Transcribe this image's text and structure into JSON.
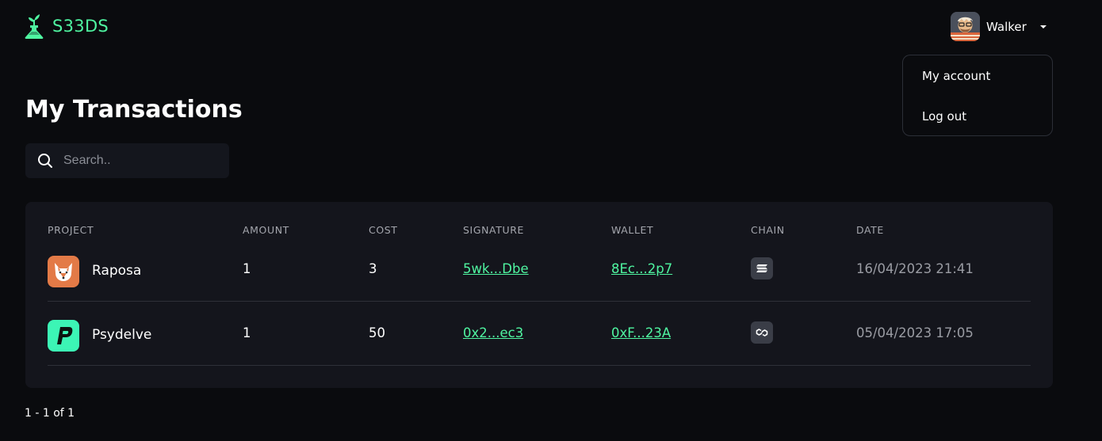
{
  "header": {
    "brand": "S33DS",
    "user_name": "Walker"
  },
  "user_menu": {
    "items": [
      {
        "label": "My account"
      },
      {
        "label": "Log out"
      }
    ]
  },
  "page": {
    "title": "My Transactions"
  },
  "search": {
    "placeholder": "Search..",
    "value": ""
  },
  "table": {
    "columns": [
      "PROJECT",
      "AMOUNT",
      "COST",
      "SIGNATURE",
      "WALLET",
      "CHAIN",
      "DATE"
    ],
    "rows": [
      {
        "project": "Raposa",
        "project_icon": "raposa-fox-logo",
        "amount": "1",
        "cost": "3",
        "signature": "5wk...Dbe",
        "wallet": "8Ec...2p7",
        "chain_icon": "solana-icon",
        "date": "16/04/2023 21:41"
      },
      {
        "project": "Psydelve",
        "project_icon": "psydelve-logo",
        "amount": "1",
        "cost": "50",
        "signature": "0x2...ec3",
        "wallet": "0xF...23A",
        "chain_icon": "polygon-icon",
        "date": "05/04/2023 17:05"
      }
    ]
  },
  "pagination": {
    "text": "1 - 1 of 1"
  },
  "colors": {
    "background": "#0a0b0e",
    "card": "#14151c",
    "accent": "#4ff5a1",
    "muted": "#9a9ca3"
  }
}
